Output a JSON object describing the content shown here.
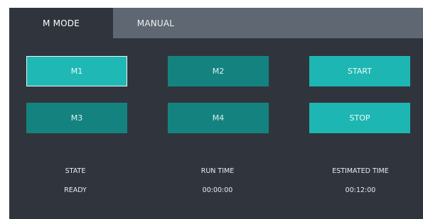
{
  "tabs": [
    {
      "label": "M MODE",
      "active": true
    },
    {
      "label": "MANUAL",
      "active": false
    }
  ],
  "buttons": {
    "m1": "M1",
    "m2": "M2",
    "m3": "M3",
    "m4": "M4",
    "start": "START",
    "stop": "STOP"
  },
  "status": {
    "state_label": "STATE",
    "state_value": "READY",
    "run_time_label": "RUN TIME",
    "run_time_value": "00:00:00",
    "estimated_time_label": "ESTIMATED TIME",
    "estimated_time_value": "00:12:00"
  },
  "colors": {
    "panel_background": "#30353d",
    "tab_bar": "#5f6772",
    "mode_button": "#14837f",
    "selected_button": "#20b8b4",
    "action_button": "#1eb6b2"
  }
}
